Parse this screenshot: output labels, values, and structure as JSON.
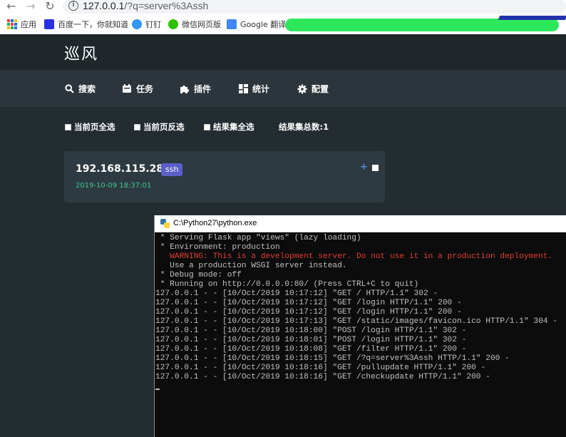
{
  "browser": {
    "url_host": "127.0.0.1",
    "url_path": "/?q=server%3Assh",
    "bookmarks": [
      {
        "label": "应用",
        "icon": "apps-grid-icon"
      },
      {
        "label": "百度一下，你就知道",
        "icon": "baidu-icon"
      },
      {
        "label": "钉钉",
        "icon": "dingtalk-icon"
      },
      {
        "label": "微信网页版",
        "icon": "wechat-icon"
      },
      {
        "label": "Google 翻译",
        "icon": "google-translate-icon"
      }
    ]
  },
  "app": {
    "title": "巡风",
    "nav": [
      {
        "label": "搜索",
        "icon": "search-icon"
      },
      {
        "label": "任务",
        "icon": "calendar-icon"
      },
      {
        "label": "插件",
        "icon": "puzzle-icon"
      },
      {
        "label": "统计",
        "icon": "dashboard-icon"
      },
      {
        "label": "配置",
        "icon": "gear-icon"
      }
    ],
    "select_all_page": "当前页全选",
    "invert_page": "当前页反选",
    "select_all_results": "结果集全选",
    "result_total": "结果集总数:1",
    "result": {
      "ip_port": "192.168.115.28:22",
      "service": "ssh",
      "time": "2019-10-09 18:37:01",
      "plus": "+"
    }
  },
  "console": {
    "title": "C:\\Python27\\python.exe",
    "lines": [
      {
        "text": " * Serving Flask app \"views\" (lazy loading)",
        "type": "normal"
      },
      {
        "text": " * Environment: production",
        "type": "normal"
      },
      {
        "text": "   WARNING: This is a development server. Do not use it in a production deployment.",
        "type": "warn"
      },
      {
        "text": "   Use a production WSGI server instead.",
        "type": "normal"
      },
      {
        "text": " * Debug mode: off",
        "type": "normal"
      },
      {
        "text": " * Running on http://0.0.0.0:80/ (Press CTRL+C to quit)",
        "type": "normal"
      },
      {
        "text": "127.0.0.1 - - [10/Oct/2019 10:17:12] \"GET / HTTP/1.1\" 302 -",
        "type": "normal"
      },
      {
        "text": "127.0.0.1 - - [10/Oct/2019 10:17:12] \"GET /login HTTP/1.1\" 200 -",
        "type": "normal"
      },
      {
        "text": "127.0.0.1 - - [10/Oct/2019 10:17:12] \"GET /login HTTP/1.1\" 200 -",
        "type": "normal"
      },
      {
        "text": "127.0.0.1 - - [10/Oct/2019 10:17:13] \"GET /static/images/favicon.ico HTTP/1.1\" 304 -",
        "type": "normal"
      },
      {
        "text": "127.0.0.1 - - [10/Oct/2019 10:18:00] \"POST /login HTTP/1.1\" 302 -",
        "type": "normal"
      },
      {
        "text": "127.0.0.1 - - [10/Oct/2019 10:18:01] \"POST /login HTTP/1.1\" 302 -",
        "type": "normal"
      },
      {
        "text": "127.0.0.1 - - [10/Oct/2019 10:18:08] \"GET /filter HTTP/1.1\" 200 -",
        "type": "normal"
      },
      {
        "text": "127.0.0.1 - - [10/Oct/2019 10:18:15] \"GET /?q=server%3Assh HTTP/1.1\" 200 -",
        "type": "normal"
      },
      {
        "text": "127.0.0.1 - - [10/Oct/2019 10:18:16] \"GET /pullupdate HTTP/1.1\" 200 -",
        "type": "normal"
      },
      {
        "text": "127.0.0.1 - - [10/Oct/2019 10:18:16] \"GET /checkupdate HTTP/1.1\" 200 -",
        "type": "normal"
      }
    ]
  },
  "colors": {
    "page_bg": "#232c31",
    "nav_bg": "#2b353b",
    "card_bg": "#2d3a41",
    "badge": "#5b5fc7",
    "date_green": "#3ec48e",
    "warning_red": "#e03c31"
  }
}
